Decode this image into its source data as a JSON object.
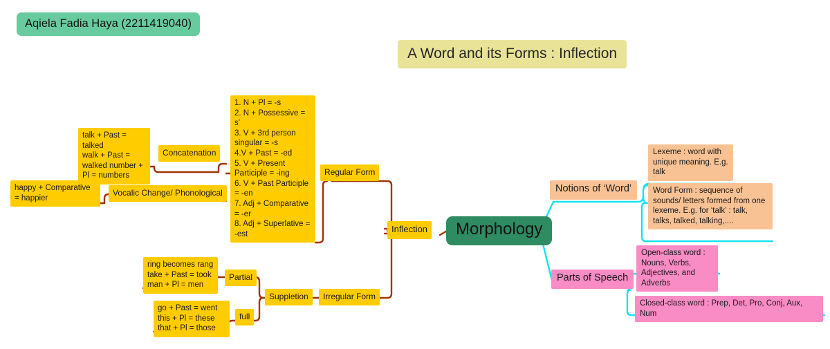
{
  "page": {
    "author_badge": "Aqiela Fadia Haya (2211419040)",
    "title": "A Word and its Forms : Inflection"
  },
  "colors": {
    "badge_green": "#68CBA0",
    "core_green": "#2E8B62",
    "title_yellow": "#E9E398",
    "node_yellow": "#FFCC00",
    "node_orange": "#F9C294",
    "node_pink": "#F98BC5",
    "wire_brown": "#A03505",
    "wire_cyan": "#16E3F0"
  },
  "core": {
    "label": "Morphology"
  },
  "inflection_branch": {
    "root_label": "Inflection",
    "regular": {
      "label": "Regular Form",
      "rules": "1. N + Pl = -s\n2. N + Possessive = s'\n3. V + 3rd person singular = -s\n4.V + Past = -ed\n5. V + Present Participle = -ing\n6. V + Past Participle = -en\n7. Adj + Comparative = -er\n8. Adj + Superlative = -est"
    },
    "irregular": {
      "label": "Irregular Form",
      "suppletion_label": "Suppletion",
      "partial_label": "Partial",
      "partial_examples": "ring becomes rang\ntake + Past = took\nman + Pl = men",
      "full_label": "full",
      "full_examples": "go + Past = went\nthis + Pl = these\nthat + Pl = those"
    },
    "concatenation": {
      "label": "Concatenation",
      "examples": "talk + Past = talked\nwalk + Past = walked number + Pl = numbers"
    },
    "vocalic": {
      "label": "Vocalic Change/ Phonological",
      "examples": "happy + Comparative = happier"
    }
  },
  "notions_branch": {
    "label": "Notions of ‘Word’",
    "items": [
      "Lexeme : word with unique meaning. E.g. talk",
      "Word Form : sequence of sounds/ letters formed from one lexeme. E.g. for ‘talk’ : talk, talks, talked, talking,...."
    ]
  },
  "parts_of_speech_branch": {
    "label": "Parts of Speech",
    "items": [
      "Open-class word : Nouns, Verbs, Adjectives, and Adverbs",
      "Closed-class word : Prep, Det, Pro, Conj, Aux, Num"
    ]
  }
}
